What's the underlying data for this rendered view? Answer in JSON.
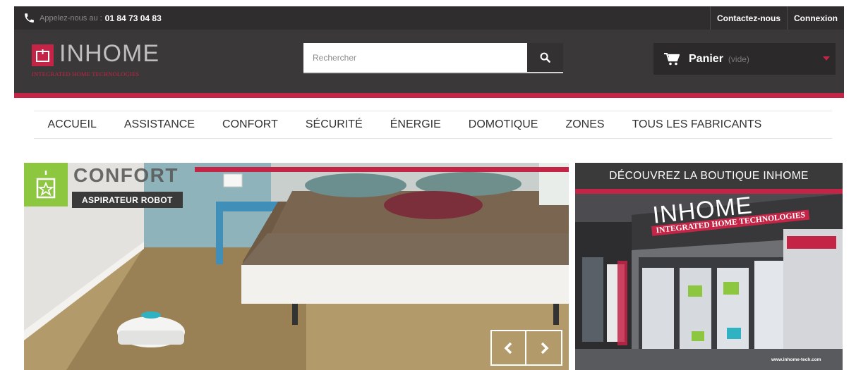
{
  "topbar": {
    "phone_icon": "phone-icon",
    "phone_prefix": "Appelez-nous au :",
    "phone_number": "01 84 73 04 83",
    "links": [
      {
        "label": "Contactez-nous"
      },
      {
        "label": "Connexion"
      }
    ]
  },
  "header": {
    "logo": {
      "word": "INHOME",
      "tagline": "INTEGRATED HOME TECHNOLOGIES"
    },
    "search": {
      "placeholder": "Rechercher",
      "icon": "search-icon"
    },
    "cart": {
      "icon": "cart-icon",
      "label": "Panier",
      "status": "(vide)"
    }
  },
  "nav": {
    "items": [
      {
        "label": "ACCUEIL"
      },
      {
        "label": "ASSISTANCE"
      },
      {
        "label": "CONFORT"
      },
      {
        "label": "SÉCURITÉ"
      },
      {
        "label": "ÉNERGIE"
      },
      {
        "label": "DOMOTIQUE"
      },
      {
        "label": "ZONES"
      },
      {
        "label": "TOUS LES FABRICANTS"
      }
    ]
  },
  "slider": {
    "category": "CONFORT",
    "tag": "ASPIRATEUR ROBOT",
    "prev_icon": "chevron-left-icon",
    "next_icon": "chevron-right-icon"
  },
  "promo": {
    "title": "DÉCOUVREZ LA BOUTIQUE INHOME",
    "store_sign": "INHOME",
    "store_tagline": "INTEGRATED HOME TECHNOLOGIES",
    "store_url": "www.inhome-tech.com"
  },
  "colors": {
    "brand_red": "#c42546",
    "dark_bar": "#2f2d2e",
    "header_bg": "#3a3839",
    "badge_green": "#8dc63f"
  }
}
